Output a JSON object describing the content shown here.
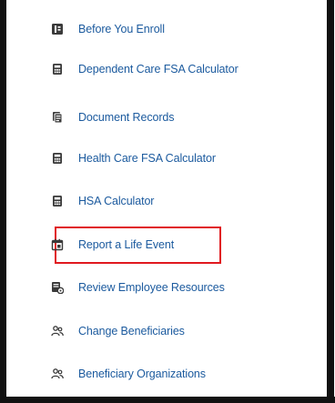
{
  "menu": {
    "items": [
      {
        "label": "Before You Enroll",
        "icon": "info-doc-icon"
      },
      {
        "label": "Dependent Care FSA Calculator",
        "icon": "calculator-icon"
      },
      {
        "label": "Document Records",
        "icon": "document-records-icon"
      },
      {
        "label": "Health Care FSA Calculator",
        "icon": "calculator-icon"
      },
      {
        "label": "HSA Calculator",
        "icon": "calculator-icon"
      },
      {
        "label": "Report a Life Event",
        "icon": "calendar-icon",
        "highlighted": true
      },
      {
        "label": "Review Employee Resources",
        "icon": "resources-icon"
      },
      {
        "label": "Change Beneficiaries",
        "icon": "people-icon"
      },
      {
        "label": "Beneficiary Organizations",
        "icon": "people-icon"
      }
    ]
  },
  "colors": {
    "link": "#1b5a9e",
    "icon": "#3a3a3a",
    "highlight_border": "#e0191f",
    "frame": "#111111"
  }
}
